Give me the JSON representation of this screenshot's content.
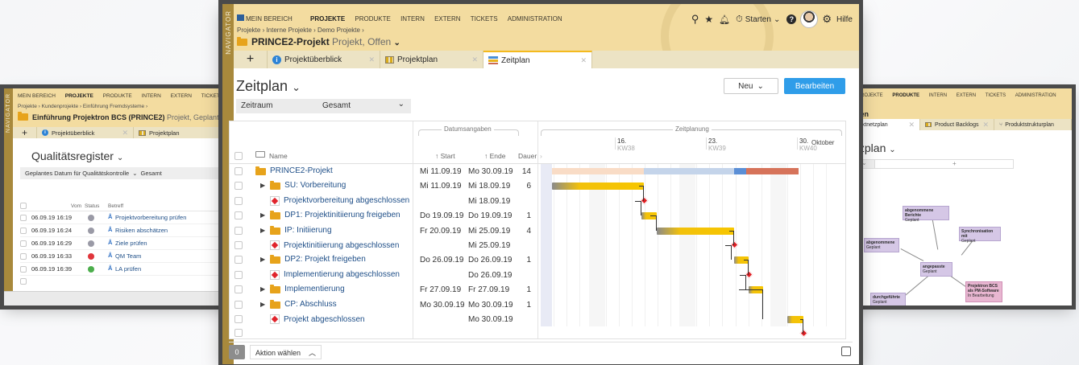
{
  "left_window": {
    "navigator_label": "NAVIGATOR",
    "menu": [
      "MEIN BEREICH",
      "PROJEKTE",
      "PRODUKTE",
      "INTERN",
      "EXTERN",
      "TICKETS"
    ],
    "active_menu": "PROJEKTE",
    "breadcrumb": "Projekte › Kundenprojekte › Einführung Fremdsysteme ›",
    "project_title": "Einführung Projektron BCS (PRINCE2)",
    "project_subtitle": "Projekt, Geplant",
    "tabs": [
      "Projektüberblick",
      "Projektplan"
    ],
    "heading": "Qualitätsregister",
    "filter_label": "Geplantes Datum für Qualitätskontrolle",
    "filter_value": "Gesamt",
    "col_vom": "Vom",
    "col_status": "Status",
    "col_betreff": "Betreff",
    "rows": [
      {
        "date": "06.09.19 16:19",
        "status": "grey",
        "subject": "Projektvorbereitung prüfen"
      },
      {
        "date": "06.09.19 16:24",
        "status": "grey",
        "subject": "Risiken abschätzen"
      },
      {
        "date": "06.09.19 16:29",
        "status": "grey",
        "subject": "Ziele prüfen"
      },
      {
        "date": "06.09.19 16:33",
        "status": "red",
        "subject": "QM Team"
      },
      {
        "date": "06.09.19 16:39",
        "status": "green",
        "subject": "LA prüfen"
      }
    ]
  },
  "right_window": {
    "menu": [
      "PROJEKTE",
      "PRODUKTE",
      "INTERN",
      "EXTERN",
      "TICKETS",
      "ADMINISTRATION"
    ],
    "active_menu": "PRODUKTE",
    "title_fragment": "gen",
    "tabs": [
      "duktnetzplan",
      "Product Backlogs",
      "Produktstrukturplan"
    ],
    "heading": "tzplan",
    "cards": [
      {
        "title": "abgenommene Berichte",
        "status": "Geplant"
      },
      {
        "title": "Synchronisation mit",
        "status": "Geplant"
      },
      {
        "title": "abgenommene",
        "status": "Geplant"
      },
      {
        "title": "angepasste",
        "status": "Geplant"
      },
      {
        "title": "Projektron BCS als PM-Software",
        "status": "In Bearbeitung"
      },
      {
        "title": "durchgeführte",
        "status": "Geplant"
      }
    ]
  },
  "main": {
    "navigator_label": "NAVIGATOR",
    "menu": [
      "MEIN BEREICH",
      "PROJEKTE",
      "PRODUKTE",
      "INTERN",
      "EXTERN",
      "TICKETS",
      "ADMINISTRATION"
    ],
    "active_menu": "PROJEKTE",
    "toolbar": {
      "starten": "Starten",
      "hilfe": "Hilfe"
    },
    "breadcrumb": "Projekte › Interne Projekte › Demo Projekte ›",
    "project_title": "PRINCE2-Projekt",
    "project_subtitle": "Projekt, Offen",
    "tabs": [
      {
        "label": "Projektüberblick",
        "icon": "info-icon"
      },
      {
        "label": "Projektplan",
        "icon": "grid-icon"
      },
      {
        "label": "Zeitplan",
        "icon": "schedule-icon",
        "active": true
      }
    ],
    "heading": "Zeitplan",
    "btn_neu": "Neu",
    "btn_bearbeiten": "Bearbeiten",
    "zeitraum_label": "Zeitraum",
    "zeitraum_value": "Gesamt",
    "group_datum": "Datumsangaben",
    "group_zeitplanung": "Zeitplanung",
    "col_name": "Name",
    "col_start": "↑ Start",
    "col_ende": "↑ Ende",
    "col_dauer": "Dauer",
    "month": "Oktober",
    "weeks": [
      {
        "day": "16.",
        "kw": "KW38"
      },
      {
        "day": "23.",
        "kw": "KW39"
      },
      {
        "day": "30.",
        "kw": "KW40"
      }
    ],
    "rows": [
      {
        "name": "PRINCE2-Projekt",
        "type": "folder",
        "expand": false,
        "start": "Mi 11.09.19",
        "end": "Mo 30.09.19",
        "dur": "14"
      },
      {
        "name": "SU: Vorbereitung",
        "type": "folder",
        "expand": true,
        "start": "Mi 11.09.19",
        "end": "Mi 18.09.19",
        "dur": "6"
      },
      {
        "name": "Projektvorbereitung abgeschlossen",
        "type": "milestone",
        "expand": false,
        "start": "",
        "end": "Mi 18.09.19",
        "dur": ""
      },
      {
        "name": "DP1: Projektinitiierung freigeben",
        "type": "folder",
        "expand": true,
        "start": "Do 19.09.19",
        "end": "Do 19.09.19",
        "dur": "1"
      },
      {
        "name": "IP: Initiierung",
        "type": "folder",
        "expand": true,
        "start": "Fr 20.09.19",
        "end": "Mi 25.09.19",
        "dur": "4"
      },
      {
        "name": "Projektinitiierung abgeschlossen",
        "type": "milestone",
        "expand": false,
        "start": "",
        "end": "Mi 25.09.19",
        "dur": ""
      },
      {
        "name": "DP2: Projekt freigeben",
        "type": "folder",
        "expand": true,
        "start": "Do 26.09.19",
        "end": "Do 26.09.19",
        "dur": "1"
      },
      {
        "name": "Implementierung abgeschlossen",
        "type": "milestone",
        "expand": false,
        "start": "",
        "end": "Do 26.09.19",
        "dur": ""
      },
      {
        "name": "Implementierung",
        "type": "folder",
        "expand": true,
        "start": "Fr 27.09.19",
        "end": "Fr 27.09.19",
        "dur": "1"
      },
      {
        "name": "CP: Abschluss",
        "type": "folder",
        "expand": true,
        "start": "Mo 30.09.19",
        "end": "Mo 30.09.19",
        "dur": "1"
      },
      {
        "name": "Projekt abgeschlossen",
        "type": "milestone",
        "expand": false,
        "start": "",
        "end": "Mo 30.09.19",
        "dur": ""
      }
    ],
    "footer_count": "0",
    "footer_action": "Aktion wählen"
  }
}
